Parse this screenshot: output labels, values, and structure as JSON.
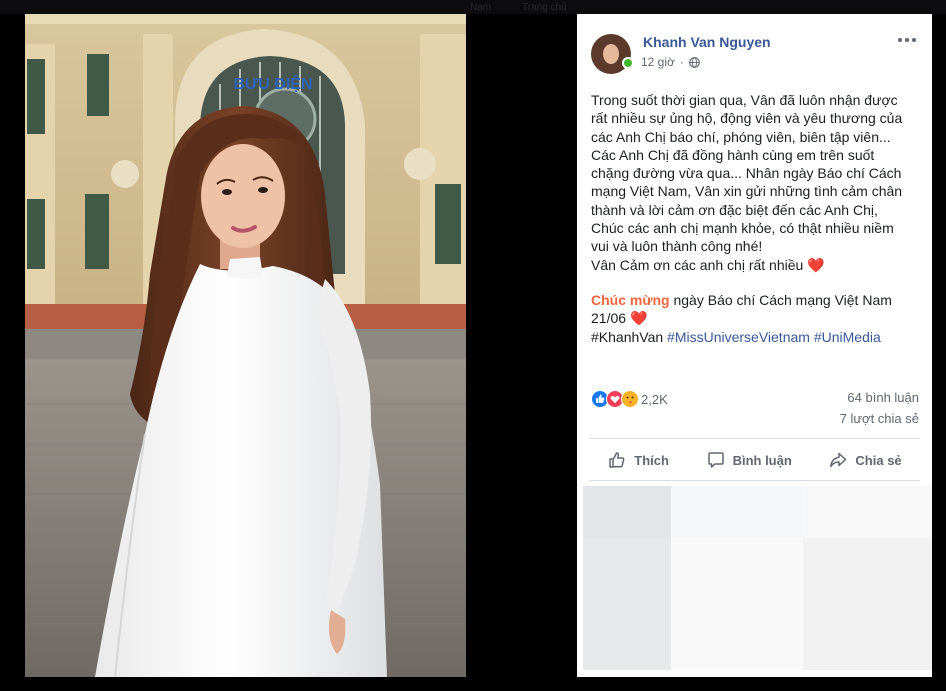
{
  "topbar": {
    "ghost_items": [
      "Nam",
      "Trang chủ"
    ]
  },
  "photo": {
    "subject": "woman-in-white-ao-dai",
    "sign_text": "BƯU ĐIỆN"
  },
  "post": {
    "author": "Khanh Van Nguyen",
    "time": "12 giờ",
    "privacy_dot": "·",
    "body_lines": [
      "Trong suốt thời gian qua, Vân đã luôn nhận được",
      "rất nhiều sự ủng hộ, động viên và yêu thương của",
      "các Anh Chị báo chí, phóng viên, biên tập viên...",
      "Các Anh Chị đã đồng hành cùng em trên suốt",
      "chặng đường vừa qua... Nhân ngày Báo chí Cách",
      "mạng Việt Nam, Vân xin gửi những tình cảm chân",
      "thành và lời cảm ơn đặc biệt đến các Anh Chị,",
      "Chúc các anh chị mạnh khỏe, có thật nhiều niềm",
      "vui và luôn thành công nhé!",
      "Vân Cảm ơn các anh chị rất nhiều"
    ],
    "heart": "❤️",
    "greeting_highlight": "Chúc mừng",
    "greeting_rest": " ngày Báo chí Cách mạng Việt Nam",
    "date_line": "21/06",
    "hashtag_plain": "#KhanhVan",
    "hashtag_links": [
      " #MissUniverseVietnam",
      " #UniMedia"
    ]
  },
  "stats": {
    "reactions_count": "2,2K",
    "comments": "64 bình luận",
    "shares": "7 lượt chia sẻ"
  },
  "actions": {
    "like": "Thích",
    "comment": "Bình luận",
    "share": "Chia sẻ"
  },
  "colors": {
    "link": "#385898",
    "highlight": "#f3653e",
    "heart": "#e0245e",
    "online": "#42b72a"
  }
}
